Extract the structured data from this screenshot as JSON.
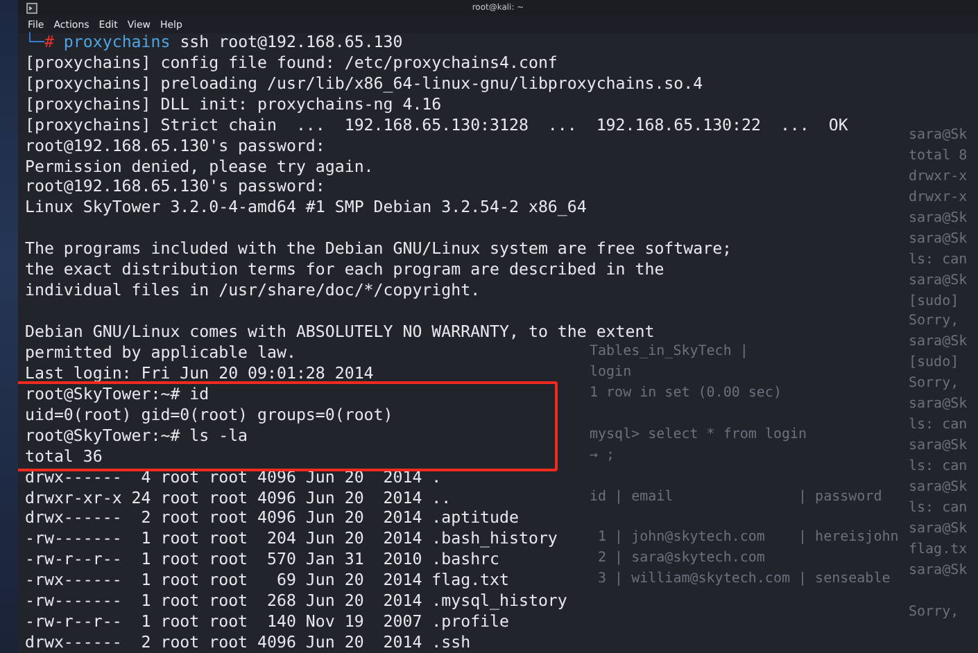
{
  "window": {
    "title": "root@kali: ~"
  },
  "menu": [
    {
      "label": "File"
    },
    {
      "label": "Actions"
    },
    {
      "label": "Edit"
    },
    {
      "label": "View"
    },
    {
      "label": "Help"
    }
  ],
  "terminal": {
    "lines": [
      {
        "kind": "prompt",
        "corner": "└─",
        "symbol": "#",
        "command": "proxychains",
        "args": "ssh root@192.168.65.130"
      },
      {
        "kind": "output",
        "text": "[proxychains] config file found: /etc/proxychains4.conf"
      },
      {
        "kind": "output",
        "text": "[proxychains] preloading /usr/lib/x86_64-linux-gnu/libproxychains.so.4"
      },
      {
        "kind": "output",
        "text": "[proxychains] DLL init: proxychains-ng 4.16"
      },
      {
        "kind": "output",
        "text": "[proxychains] Strict chain  ...  192.168.65.130:3128  ...  192.168.65.130:22  ...  OK"
      },
      {
        "kind": "output",
        "text": "root@192.168.65.130's password:"
      },
      {
        "kind": "output",
        "text": "Permission denied, please try again."
      },
      {
        "kind": "output",
        "text": "root@192.168.65.130's password:"
      },
      {
        "kind": "output",
        "text": "Linux SkyTower 3.2.0-4-amd64 #1 SMP Debian 3.2.54-2 x86_64"
      },
      {
        "kind": "blank"
      },
      {
        "kind": "output",
        "text": "The programs included with the Debian GNU/Linux system are free software;"
      },
      {
        "kind": "output",
        "text": "the exact distribution terms for each program are described in the"
      },
      {
        "kind": "output",
        "text": "individual files in /usr/share/doc/*/copyright."
      },
      {
        "kind": "blank"
      },
      {
        "kind": "output",
        "text": "Debian GNU/Linux comes with ABSOLUTELY NO WARRANTY, to the extent"
      },
      {
        "kind": "output",
        "text": "permitted by applicable law."
      },
      {
        "kind": "output",
        "text": "Last login: Fri Jun 20 09:01:28 2014"
      },
      {
        "kind": "output",
        "text": "root@SkyTower:~# id"
      },
      {
        "kind": "output",
        "text": "uid=0(root) gid=0(root) groups=0(root)"
      },
      {
        "kind": "output",
        "text": "root@SkyTower:~# ls -la"
      },
      {
        "kind": "output",
        "text": "total 36"
      },
      {
        "kind": "output",
        "text": "drwx------  4 root root 4096 Jun 20  2014 ."
      },
      {
        "kind": "output",
        "text": "drwxr-xr-x 24 root root 4096 Jun 20  2014 .."
      },
      {
        "kind": "output",
        "text": "drwx------  2 root root 4096 Jun 20  2014 .aptitude"
      },
      {
        "kind": "output",
        "text": "-rw-------  1 root root  204 Jun 20  2014 .bash_history"
      },
      {
        "kind": "output",
        "text": "-rw-r--r--  1 root root  570 Jan 31  2010 .bashrc"
      },
      {
        "kind": "output",
        "text": "-rwx------  1 root root   69 Jun 20  2014 flag.txt"
      },
      {
        "kind": "output",
        "text": "-rw-------  1 root root  268 Jun 20  2014 .mysql_history"
      },
      {
        "kind": "output",
        "text": "-rw-r--r--  1 root root  140 Nov 19  2007 .profile"
      },
      {
        "kind": "output",
        "text": "drwx------  2 root root 4096 Jun 20  2014 .ssh"
      }
    ]
  },
  "background_mysql_window": {
    "lines": [
      {
        "kind": "text",
        "text": "Tables_in_SkyTech |"
      },
      {
        "kind": "text",
        "text": "login"
      },
      {
        "kind": "text",
        "text": "1 row in set (0.00 sec)"
      },
      {
        "kind": "blank"
      },
      {
        "kind": "text",
        "text": "mysql> select * from login"
      },
      {
        "kind": "text",
        "text": "→ ;"
      },
      {
        "kind": "blank"
      },
      {
        "kind": "text",
        "text": "id | email               | password"
      },
      {
        "kind": "blank"
      },
      {
        "kind": "text",
        "text": " 1 | john@skytech.com    | hereisjohn"
      },
      {
        "kind": "text",
        "text": " 2 | sara@skytech.com"
      },
      {
        "kind": "text",
        "text": " 3 | william@skytech.com | senseable"
      }
    ]
  },
  "background_shell_window": {
    "lines": [
      {
        "kind": "text",
        "text": "sara@Sk"
      },
      {
        "kind": "text",
        "text": "total 8"
      },
      {
        "kind": "text",
        "text": "drwxr-x"
      },
      {
        "kind": "text",
        "text": "drwxr-x"
      },
      {
        "kind": "text",
        "text": "sara@Sk"
      },
      {
        "kind": "text",
        "text": "sara@Sk"
      },
      {
        "kind": "text",
        "text": "ls: can"
      },
      {
        "kind": "text",
        "text": "sara@Sk"
      },
      {
        "kind": "text",
        "text": "[sudo]"
      },
      {
        "kind": "text",
        "text": "Sorry,"
      },
      {
        "kind": "text",
        "text": "sara@Sk"
      },
      {
        "kind": "text",
        "text": "[sudo]"
      },
      {
        "kind": "text",
        "text": "Sorry,"
      },
      {
        "kind": "text",
        "text": "sara@Sk"
      },
      {
        "kind": "text",
        "text": "ls: can"
      },
      {
        "kind": "text",
        "text": "sara@Sk"
      },
      {
        "kind": "text",
        "text": "ls: can"
      },
      {
        "kind": "text",
        "text": "sara@Sk"
      },
      {
        "kind": "text",
        "text": "ls: can"
      },
      {
        "kind": "text",
        "text": "sara@Sk"
      },
      {
        "kind": "text",
        "text": "flag.tx"
      },
      {
        "kind": "text",
        "text": "sara@Sk"
      },
      {
        "kind": "blank"
      },
      {
        "kind": "text",
        "text": "Sorry,"
      }
    ]
  }
}
